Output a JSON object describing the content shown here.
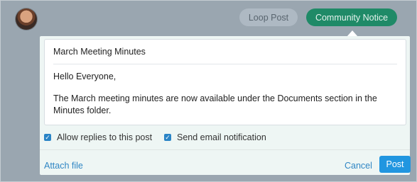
{
  "header": {
    "loop_post_label": "Loop Post",
    "community_notice_label": "Community Notice"
  },
  "post": {
    "subject": "March Meeting Minutes",
    "greeting": "Hello Everyone,",
    "body": "The March meeting minutes are now available under the Documents section in the Minutes folder."
  },
  "options": {
    "allow_replies_label": "Allow replies to this post",
    "allow_replies_checked": true,
    "send_email_label": "Send email notification",
    "send_email_checked": true
  },
  "footer": {
    "attach_label": "Attach file",
    "cancel_label": "Cancel",
    "post_label": "Post"
  },
  "colors": {
    "accent_green": "#1f8a67",
    "accent_blue": "#2196e0",
    "link_blue": "#2f86c4"
  }
}
